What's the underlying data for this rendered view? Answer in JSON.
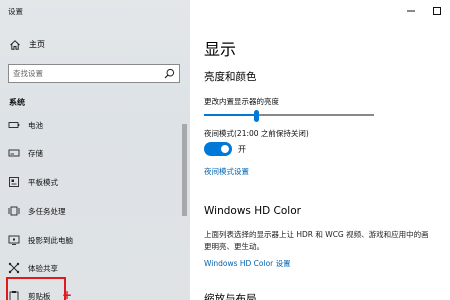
{
  "window": {
    "title": "设置",
    "controls": [
      "minimize-icon",
      "maximize-icon"
    ]
  },
  "sidebar": {
    "home_label": "主页",
    "search_placeholder": "查找设置",
    "section": "系统",
    "items": [
      {
        "label": "电池",
        "icon": "battery-icon"
      },
      {
        "label": "存储",
        "icon": "storage-icon"
      },
      {
        "label": "平板模式",
        "icon": "tablet-mode-icon"
      },
      {
        "label": "多任务处理",
        "icon": "multitasking-icon"
      },
      {
        "label": "投影到此电脑",
        "icon": "projecting-icon"
      },
      {
        "label": "体验共享",
        "icon": "shared-experiences-icon"
      },
      {
        "label": "剪贴板",
        "icon": "clipboard-icon"
      }
    ]
  },
  "main": {
    "page_title": "显示",
    "brightness_section": {
      "heading": "亮度和颜色",
      "brightness_label": "更改内置显示器的亮度",
      "brightness_level": 0.3,
      "night_light_label": "夜间模式(21:00 之前保持关闭)",
      "night_light_state": "开",
      "night_light_link": "夜间模式设置"
    },
    "hd_color_section": {
      "heading": "Windows HD Color",
      "description_line1": "上面列表选择的显示器上让 HDR 和 WCG 视频、游戏和应用中的画",
      "description_line2": "更明亮、更生动。",
      "link": "Windows HD Color 设置"
    },
    "scale_section": {
      "heading": "缩放与布局"
    }
  },
  "colors": {
    "accent": "#0078d7",
    "link": "#0063b1",
    "annotation": "#e0191f"
  }
}
